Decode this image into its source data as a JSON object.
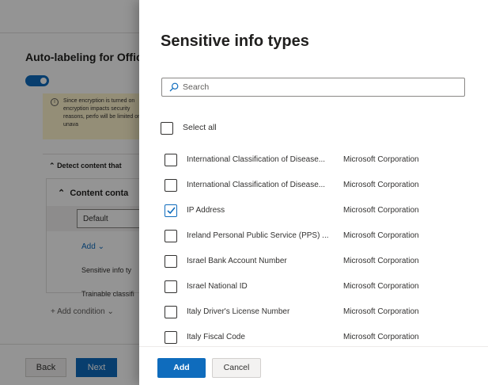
{
  "background": {
    "title": "Auto-labeling for Office",
    "toggle_state": "on",
    "warning_text": "Since encryption is turned on encryption impacts security reasons, perfo will be limited or unava",
    "detect_header": "Detect content that",
    "content_header": "Content conta",
    "default_value": "Default",
    "add_label": "Add",
    "menu_items": [
      "Sensitive info ty",
      "Trainable classifi"
    ],
    "add_condition": "Add condition",
    "back_label": "Back",
    "next_label": "Next"
  },
  "panel": {
    "title": "Sensitive info types",
    "search_placeholder": "Search",
    "select_all_label": "Select all",
    "items": [
      {
        "name": "International Classification of Disease...",
        "publisher": "Microsoft Corporation",
        "checked": false
      },
      {
        "name": "International Classification of Disease...",
        "publisher": "Microsoft Corporation",
        "checked": false
      },
      {
        "name": "IP Address",
        "publisher": "Microsoft Corporation",
        "checked": true
      },
      {
        "name": "Ireland Personal Public Service (PPS) ...",
        "publisher": "Microsoft Corporation",
        "checked": false
      },
      {
        "name": "Israel Bank Account Number",
        "publisher": "Microsoft Corporation",
        "checked": false
      },
      {
        "name": "Israel National ID",
        "publisher": "Microsoft Corporation",
        "checked": false
      },
      {
        "name": "Italy Driver's License Number",
        "publisher": "Microsoft Corporation",
        "checked": false
      },
      {
        "name": "Italy Fiscal Code",
        "publisher": "Microsoft Corporation",
        "checked": false
      }
    ],
    "add_label": "Add",
    "cancel_label": "Cancel"
  },
  "colors": {
    "accent": "#0f6cbd",
    "warning_bg": "#fff4ce",
    "text": "#323130"
  }
}
